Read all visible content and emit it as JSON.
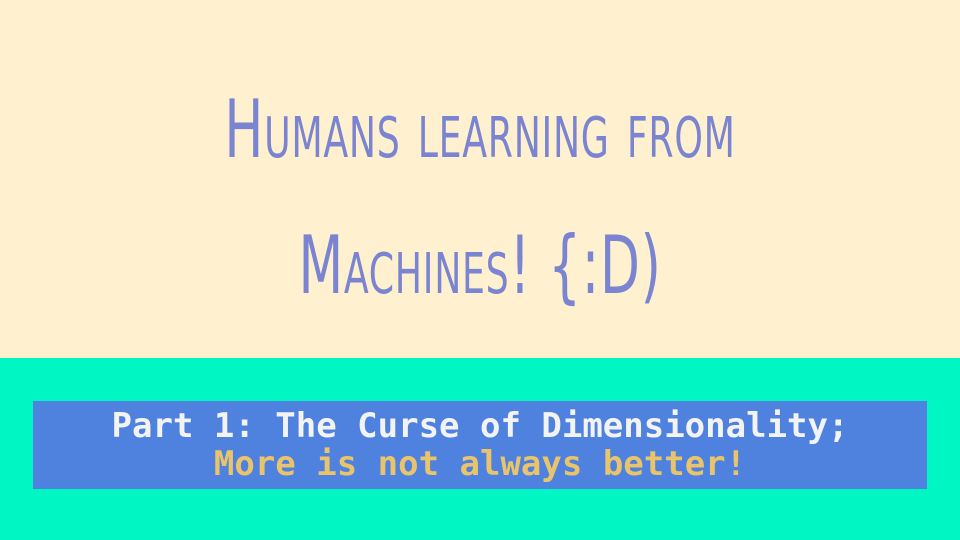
{
  "slide": {
    "title_line1": "Humans learning from",
    "title_line2": "Machines! {:D)",
    "subtitle_line1": "Part 1: The Curse of Dimensionality;",
    "subtitle_line2": "More is not always better!"
  },
  "colors": {
    "top_background": "#fff1cf",
    "title_text": "#7a84d0",
    "bottom_background": "#00f7c3",
    "subtitle_box": "#4f82de",
    "subtitle_line1_text": "#f3f3f3",
    "subtitle_line2_text": "#e9c46a"
  }
}
